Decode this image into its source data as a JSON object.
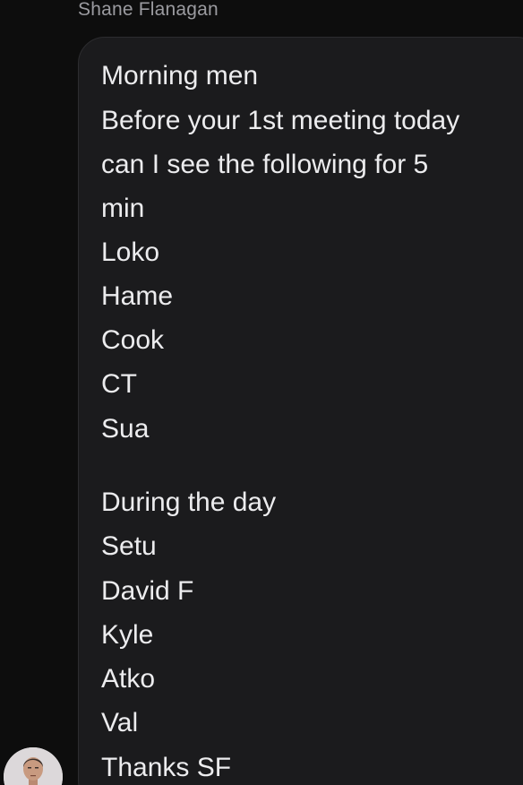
{
  "conversation": {
    "sender_name": "Shane Flanagan",
    "message_lines": [
      "Morning men",
      "Before your 1st meeting today",
      "can I see the following for 5",
      "min",
      "Loko",
      "Hame",
      "Cook",
      "CT",
      "Sua",
      "During the day",
      "Setu",
      "David F",
      "Kyle",
      "Atko",
      "Val",
      "Thanks SF"
    ]
  },
  "colors": {
    "background": "#0d0d0d",
    "bubble": "#1b1b1d",
    "text": "#ececee",
    "sender": "#9b9ba0"
  },
  "icons": {
    "avatar": "user-avatar-photo"
  }
}
